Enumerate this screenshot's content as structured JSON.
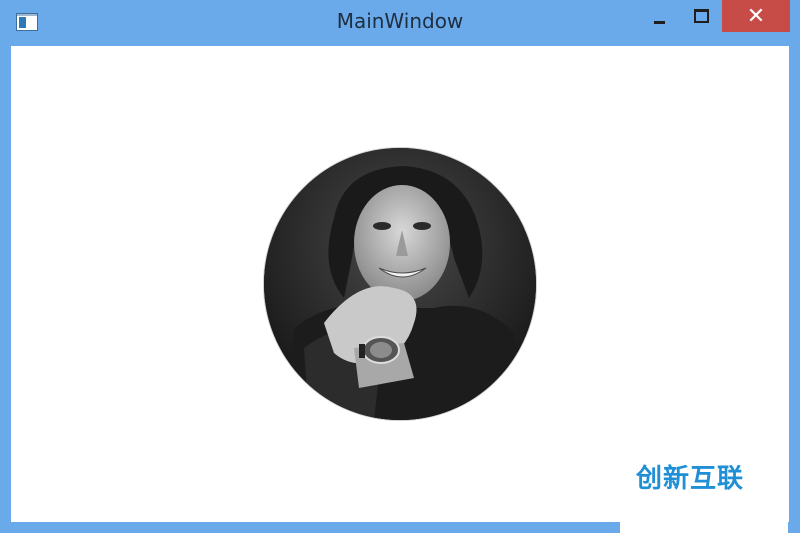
{
  "window": {
    "title": "MainWindow",
    "close_glyph": "✕"
  },
  "icons": {
    "app": "app-window-icon",
    "minimize": "minimize-icon",
    "maximize": "maximize-icon",
    "close": "close-icon"
  },
  "colors": {
    "frame": "#6aa9ea",
    "close_button": "#c74b47",
    "client_background": "#ffffff",
    "watermark": "#1f8fd6"
  },
  "watermark": {
    "text": "创新互联"
  }
}
